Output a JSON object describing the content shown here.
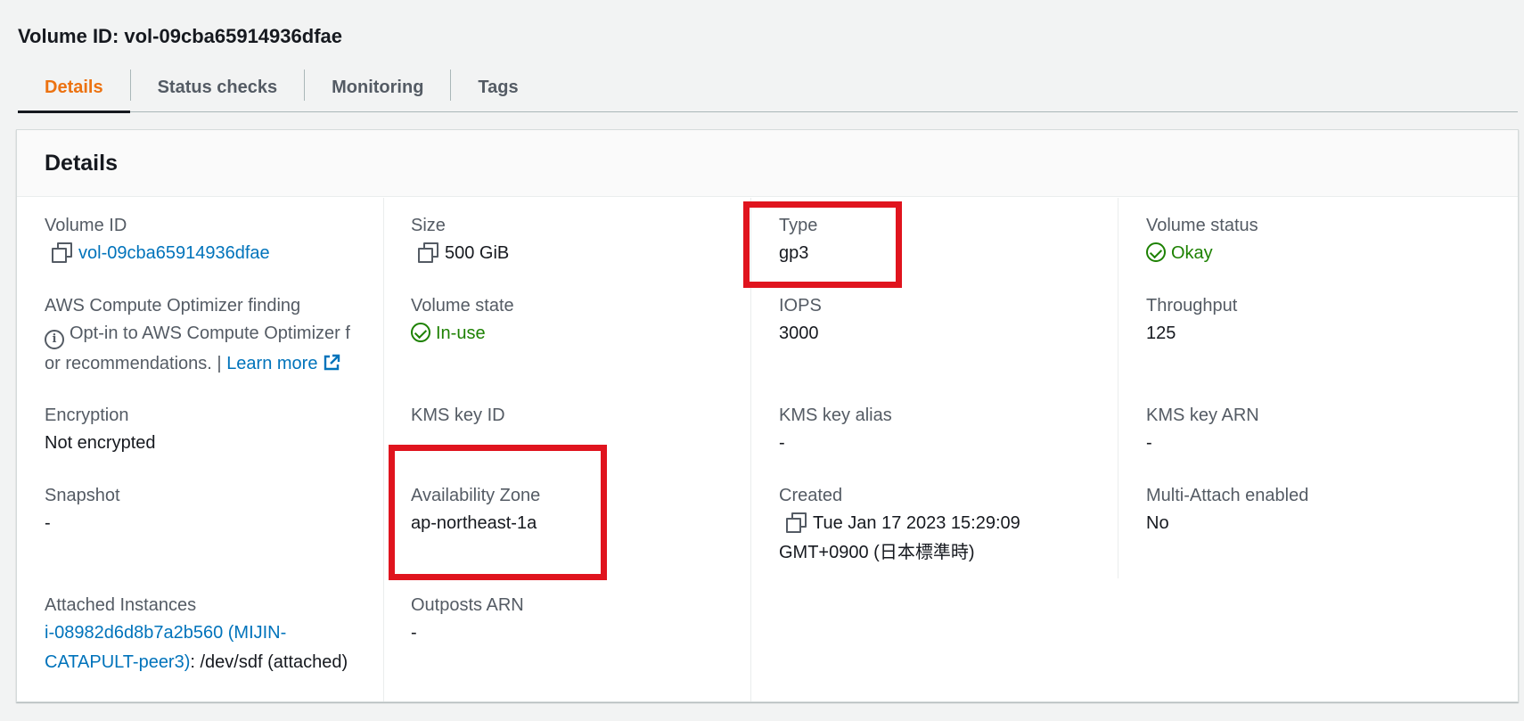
{
  "header": {
    "title": "Volume ID: vol-09cba65914936dfae"
  },
  "tabs": [
    {
      "label": "Details",
      "active": true
    },
    {
      "label": "Status checks",
      "active": false
    },
    {
      "label": "Monitoring",
      "active": false
    },
    {
      "label": "Tags",
      "active": false
    }
  ],
  "panel": {
    "title": "Details"
  },
  "fields": {
    "volume_id": {
      "label": "Volume ID",
      "value": "vol-09cba65914936dfae"
    },
    "size": {
      "label": "Size",
      "value": "500 GiB"
    },
    "type": {
      "label": "Type",
      "value": "gp3"
    },
    "volume_status": {
      "label": "Volume status",
      "value": "Okay"
    },
    "optimizer": {
      "label": "AWS Compute Optimizer finding",
      "text_line1": "Opt-in to AWS Compute Optimizer f",
      "text_line2": "or recommendations. |",
      "link": "Learn more"
    },
    "volume_state": {
      "label": "Volume state",
      "value": "In-use"
    },
    "iops": {
      "label": "IOPS",
      "value": "3000"
    },
    "throughput": {
      "label": "Throughput",
      "value": "125"
    },
    "encryption": {
      "label": "Encryption",
      "value": "Not encrypted"
    },
    "kms_key_id": {
      "label": "KMS key ID",
      "value": ""
    },
    "kms_key_alias": {
      "label": "KMS key alias",
      "value": "-"
    },
    "kms_key_arn": {
      "label": "KMS key ARN",
      "value": "-"
    },
    "snapshot": {
      "label": "Snapshot",
      "value": "-"
    },
    "availability_zone": {
      "label": "Availability Zone",
      "value": "ap-northeast-1a"
    },
    "created": {
      "label": "Created",
      "value_line1": "Tue Jan 17 2023 15:29:09",
      "value_line2": "GMT+0900 (日本標準時)"
    },
    "multi_attach": {
      "label": "Multi-Attach enabled",
      "value": "No"
    },
    "attached_instances": {
      "label": "Attached Instances",
      "link_line1": "i-08982d6d8b7a2b560 (MIJIN-",
      "link_line2": "CATAPULT-peer3)",
      "suffix": ": /dev/sdf (attached)"
    },
    "outposts_arn": {
      "label": "Outposts ARN",
      "value": "-"
    }
  },
  "colors": {
    "accent_tab": "#ec7211",
    "link": "#0073bb",
    "success": "#1d8102",
    "highlight": "#e0141e"
  },
  "icons": [
    "copy-icon",
    "check-circle-icon",
    "info-icon",
    "external-link-icon"
  ]
}
